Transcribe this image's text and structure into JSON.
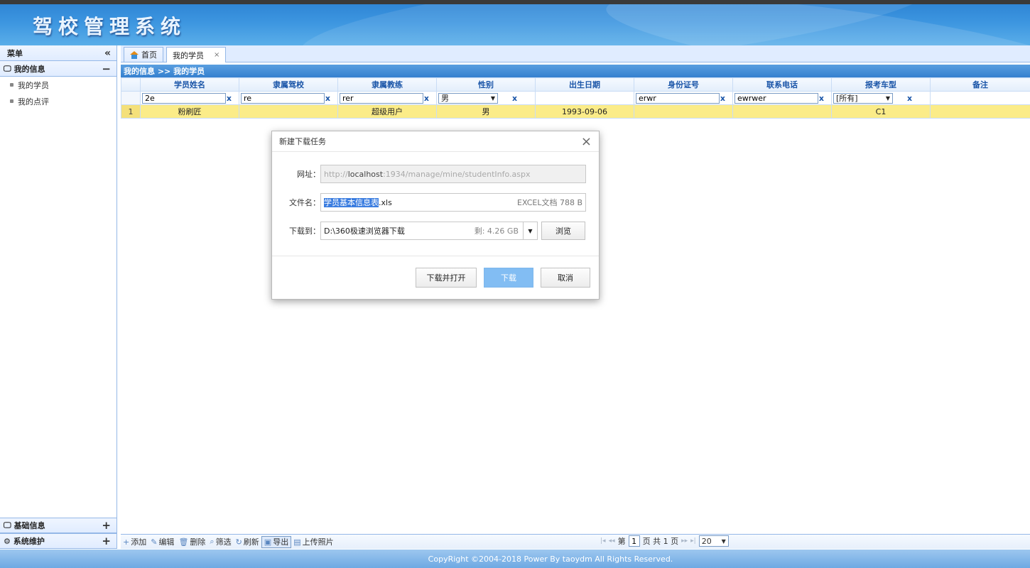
{
  "app": {
    "title": "驾校管理系统"
  },
  "sidebar": {
    "header": "菜单",
    "collapse_icon": "«",
    "sections": [
      {
        "label": "我的信息",
        "toggle": "−",
        "items": [
          "我的学员",
          "我的点评"
        ]
      }
    ],
    "bottom_sections": [
      {
        "label": "基础信息",
        "toggle": "+"
      },
      {
        "label": "系统维护",
        "toggle": "+"
      }
    ]
  },
  "tabs": [
    {
      "label": "首页"
    },
    {
      "label": "我的学员",
      "close": "×"
    }
  ],
  "breadcrumb": "我的信息 >> 我的学员",
  "grid": {
    "columns": [
      "学员姓名",
      "隶属驾校",
      "隶属教练",
      "性别",
      "出生日期",
      "身份证号",
      "联系电话",
      "报考车型",
      "备注"
    ],
    "filters": {
      "name": "2e",
      "school": "re",
      "coach": "rer",
      "gender": "男",
      "id_card": "erwr",
      "phone": "ewrwer",
      "car_type": "[所有]",
      "clear": "x"
    },
    "rows": [
      {
        "num": "1",
        "name": "粉刷匠",
        "school": "",
        "coach": "超级用户",
        "gender": "男",
        "birth": "1993-09-06",
        "id_card": "",
        "phone": "",
        "car_type": "C1",
        "remark": ""
      }
    ]
  },
  "toolbar": {
    "add": "添加",
    "edit": "编辑",
    "delete": "删除",
    "filter": "筛选",
    "refresh": "刷新",
    "export": "导出",
    "upload": "上传照片"
  },
  "pager": {
    "page_prefix": "第",
    "page": "1",
    "page_suffix": "页 共 1 页",
    "page_size": "20"
  },
  "copyright": "CopyRight ©2004-2018 Power By taoydm   All Rights Reserved.",
  "dialog": {
    "title": "新建下载任务",
    "close": "×",
    "url_label": "网址：",
    "url_prefix": "http://",
    "url_host": "localhost",
    "url_rest": ":1934/manage/mine/studentInfo.aspx",
    "filename_label": "文件名：",
    "filename_selected": "学员基本信息表",
    "filename_ext": ".xls",
    "file_meta": "EXCEL文档 788 B",
    "saveto_label": "下载到：",
    "saveto_path": "D:\\360极速浏览器下载",
    "free_space": "剩: 4.26 GB",
    "browse": "浏览",
    "btn_open": "下载并打开",
    "btn_download": "下载",
    "btn_cancel": "取消"
  }
}
